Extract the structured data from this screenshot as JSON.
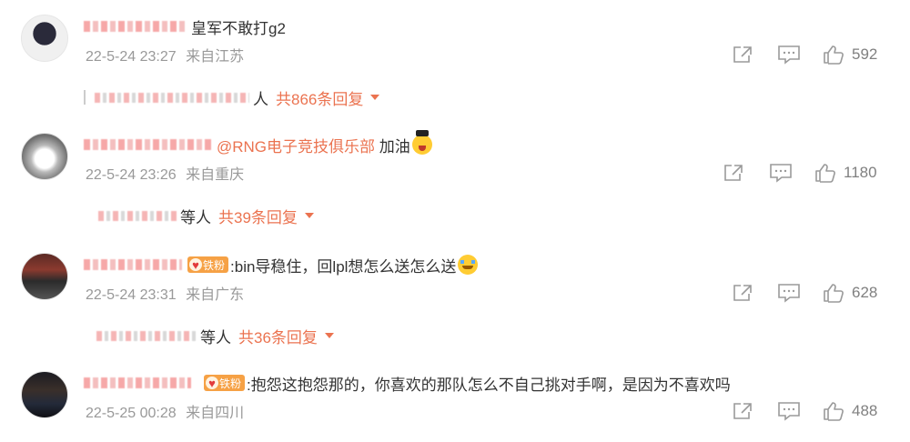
{
  "comments": [
    {
      "text": "皇军不敢打g2",
      "time": "22-5-24 23:27",
      "location": "来自江苏",
      "likes": "592",
      "reply_suffix": "人",
      "reply_link": "共866条回复"
    },
    {
      "mention": "@RNG电子竞技俱乐部",
      "text": " 加油",
      "emoji": "cheer-emoji",
      "time": "22-5-24 23:26",
      "location": "来自重庆",
      "likes": "1180",
      "reply_suffix": "等人",
      "reply_link": "共39条回复"
    },
    {
      "badge": "铁粉",
      "text": ":bin导稳住，回lpl想怎么送怎么送",
      "emoji": "crying-emoji",
      "time": "22-5-24 23:31",
      "location": "来自广东",
      "likes": "628",
      "reply_suffix": "等人",
      "reply_link": "共36条回复"
    },
    {
      "badge": "铁粉",
      "text": ":抱怨这抱怨那的，你喜欢的那队怎么不自己挑对手啊，是因为不喜欢吗",
      "time": "22-5-25 00:28",
      "location": "来自四川",
      "likes": "488"
    }
  ],
  "icons": {
    "share": "share-icon",
    "comment": "comment-icon",
    "like": "like-icon"
  },
  "colors": {
    "accent": "#eb7350",
    "meta": "#999999",
    "badge": "#f6a145"
  }
}
